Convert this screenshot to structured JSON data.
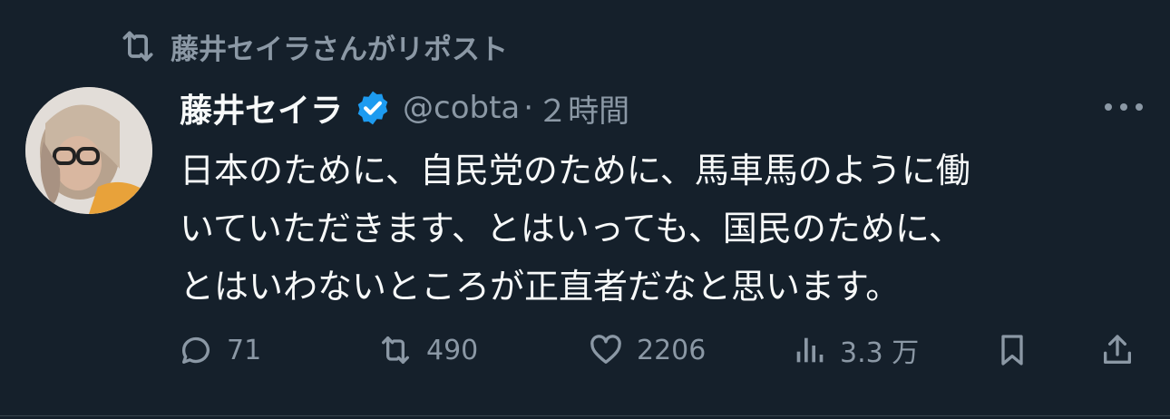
{
  "repost": {
    "icon": "repost-icon",
    "text": "藤井セイラさんがリポスト"
  },
  "tweet": {
    "author_name": "藤井セイラ",
    "verified_icon": "verified-badge-icon",
    "handle": "@cobta",
    "separator": "·",
    "time": "２時間",
    "more_icon": "more-options-icon",
    "body_lines": [
      "日本のために、自民党のために、馬車馬のように働",
      "いていただきます、とはいっても、国民のために、",
      "とはいわないところが正直者だなと思います。"
    ]
  },
  "actions": {
    "reply": {
      "icon": "reply-icon",
      "count": "71"
    },
    "repost": {
      "icon": "repost-icon",
      "count": "490"
    },
    "like": {
      "icon": "like-heart-icon",
      "count": "2206"
    },
    "views": {
      "icon": "views-chart-icon",
      "count": "3.3 万"
    },
    "bookmark": {
      "icon": "bookmark-icon"
    },
    "share": {
      "icon": "share-icon"
    }
  },
  "colors": {
    "background": "#15202b",
    "text": "#f7f9f9",
    "muted": "#8b98a5",
    "verified": "#1d9bf0"
  }
}
